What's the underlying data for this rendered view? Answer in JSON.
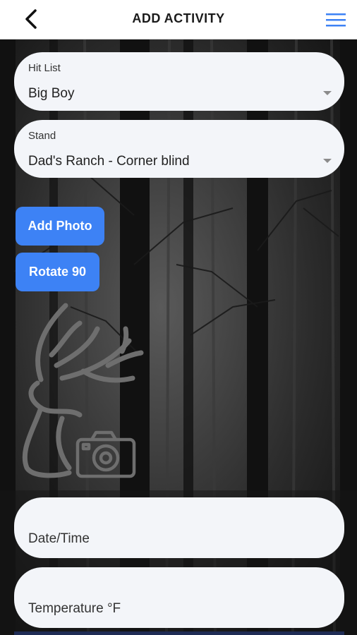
{
  "header": {
    "title": "ADD ACTIVITY",
    "back_icon": "chevron-left-icon",
    "menu_icon": "hamburger-menu-icon",
    "accent_color": "#3d82f5"
  },
  "form": {
    "hit_list": {
      "label": "Hit List",
      "value": "Big Boy"
    },
    "stand": {
      "label": "Stand",
      "value": "Dad's Ranch - Corner blind"
    },
    "add_photo_label": "Add Photo",
    "rotate_label": "Rotate 90",
    "photo_placeholder_icon": "deer-camera-icon",
    "date_time_placeholder": "Date/Time",
    "temperature_placeholder": "Temperature °F"
  },
  "colors": {
    "button": "#3d82f5",
    "field": "#f3f5f9",
    "background": "#1b1b1b"
  }
}
